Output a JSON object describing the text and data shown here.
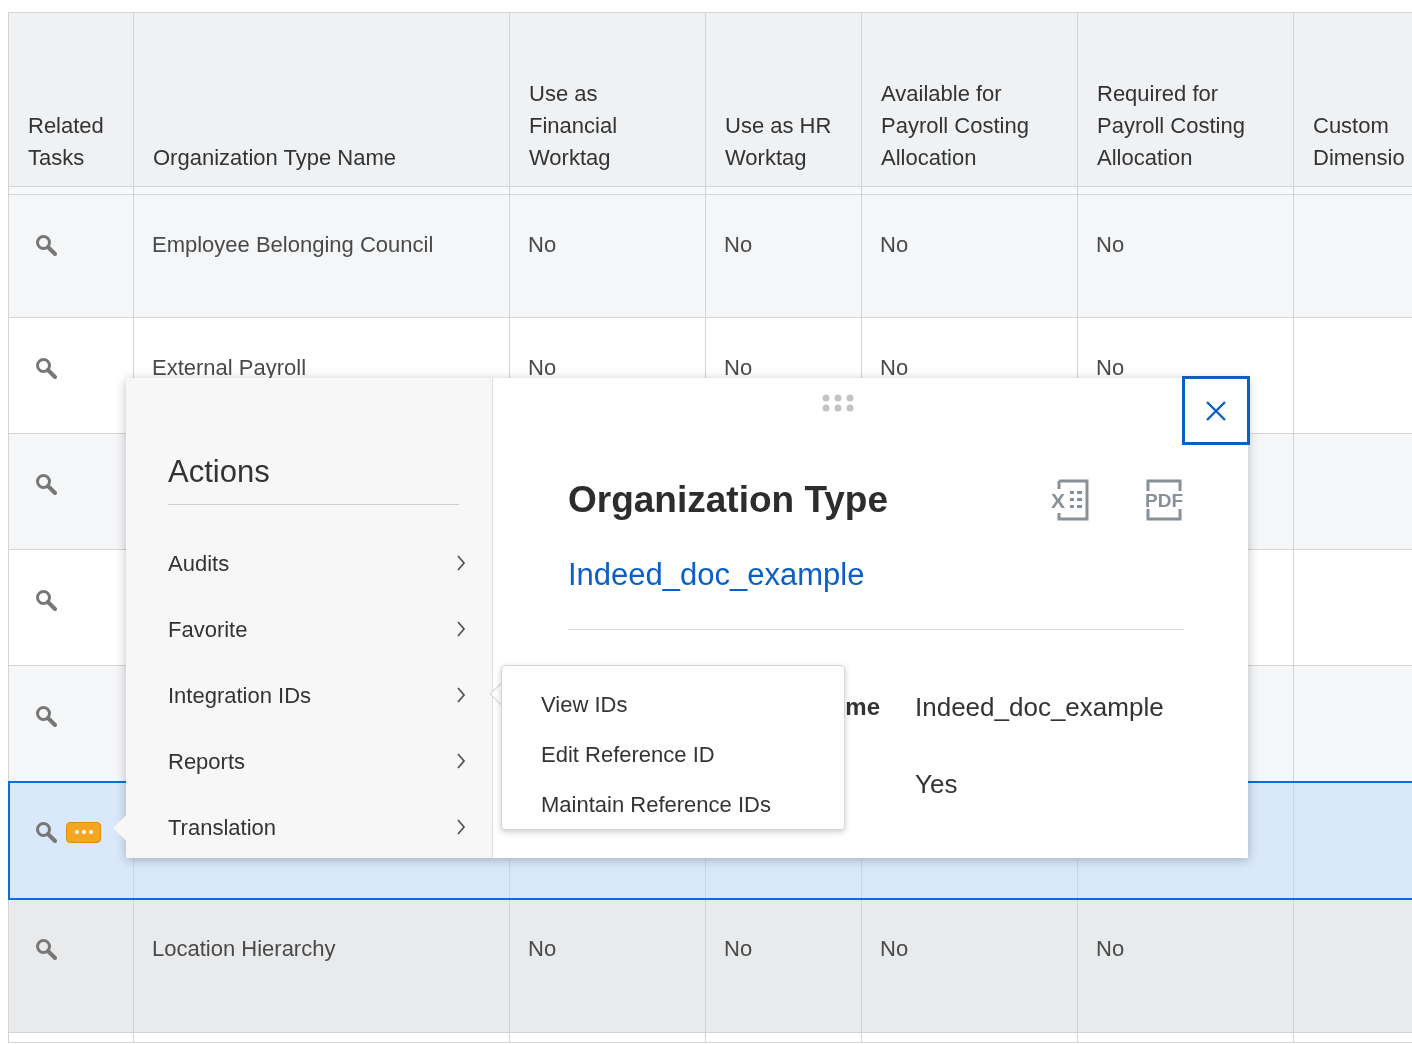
{
  "table": {
    "columns": [
      "Related\nTasks",
      "Organization Type Name",
      "Use as\nFinancial\nWorktag",
      "Use as HR\nWorktag",
      "Available for\nPayroll Costing\nAllocation",
      "Required for\nPayroll Costing\nAllocation",
      "Custom\nDimensio"
    ],
    "rows": [
      {
        "cells": [
          "",
          "Employee Belonging Council",
          "No",
          "No",
          "No",
          "No"
        ],
        "selected": false,
        "hovered": false,
        "show_actions": false
      },
      {
        "cells": [
          "",
          "External Payroll",
          "No",
          "No",
          "No",
          "No"
        ],
        "selected": false,
        "hovered": false,
        "show_actions": false
      },
      {
        "cells": [],
        "selected": false,
        "hovered": false,
        "show_actions": false
      },
      {
        "cells": [],
        "selected": false,
        "hovered": false,
        "show_actions": false
      },
      {
        "cells": [],
        "selected": false,
        "hovered": false,
        "show_actions": false
      },
      {
        "cells": [],
        "selected": true,
        "hovered": false,
        "show_actions": true
      },
      {
        "cells": [
          "",
          "Location Hierarchy",
          "No",
          "No",
          "No",
          "No"
        ],
        "selected": false,
        "hovered": true,
        "show_actions": false
      }
    ]
  },
  "popup": {
    "actions": {
      "heading": "Actions",
      "items": [
        {
          "label": "Audits"
        },
        {
          "label": "Favorite"
        },
        {
          "label": "Integration IDs",
          "submenu": [
            "View IDs",
            "Edit Reference ID",
            "Maintain Reference IDs"
          ]
        },
        {
          "label": "Reports"
        },
        {
          "label": "Translation"
        }
      ]
    },
    "detail": {
      "title": "Organization Type",
      "link": "Indeed_doc_example",
      "export_buttons": [
        {
          "kind": "excel",
          "glyph": "X"
        },
        {
          "kind": "pdf",
          "glyph": "PDF"
        }
      ],
      "fields": [
        {
          "label": "me",
          "value": "Indeed_doc_example"
        },
        {
          "value": "Yes"
        }
      ]
    }
  }
}
